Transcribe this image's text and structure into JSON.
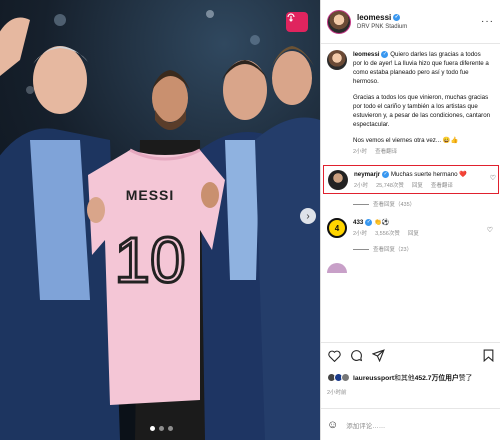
{
  "post": {
    "author": "leomessi",
    "location": "DRV PNK Stadium",
    "caption_paragraphs": [
      "Quiero darles las gracias a todos por lo de ayer! La lluvia hizo que fuera diferente a como estaba planeado pero así y todo fue hermoso.",
      "Gracias a todos los que vinieron, muchas gracias por todo el cariño y también a los artistas que estuvieron y, a pesar de las condiciones, cantaron espectacular.",
      "Nos vemos el viernes otra vez... 😄👍"
    ],
    "caption_time": "2小时",
    "caption_translate": "查看翻译",
    "likes_users": "laureussport",
    "likes_joiner": "和其他",
    "likes_count": "452.7万位用户",
    "likes_suffix": "赞了",
    "time_ago": "2小时前"
  },
  "jersey": {
    "name": "MESSI",
    "number": "10"
  },
  "comments": [
    {
      "user": "neymarjr",
      "text": "Muchas suerte hermano",
      "emoji": "❤️",
      "time": "2小时",
      "likes": "25,748次赞",
      "reply": "回复",
      "translate": "查看翻译",
      "view_replies": "查看回复（435）"
    },
    {
      "user": "433",
      "avatar_text": "4",
      "text": "👏⚽",
      "time": "2小时",
      "likes": "3,556次赞",
      "reply": "回复",
      "view_replies": "查看回复（23）"
    }
  ],
  "add_comment": {
    "placeholder": "添加评论……"
  },
  "icons": {
    "save": "save-icon",
    "more": "more-options-icon",
    "like": "heart-icon",
    "comment": "comment-icon",
    "share": "share-icon",
    "bookmark": "bookmark-icon",
    "emoji": "emoji-icon",
    "next": "chevron-right-icon"
  },
  "colors": {
    "verified": "#3897f0",
    "highlight_box": "#e0212e",
    "jersey_pink": "#f4c6d6",
    "save_button": "#e0245e"
  },
  "ui": {
    "more_glyph": "···",
    "verified_glyph": "✓",
    "next_glyph": "›",
    "emoji_glyph": "☺",
    "comment_heart_glyph": "♡"
  }
}
